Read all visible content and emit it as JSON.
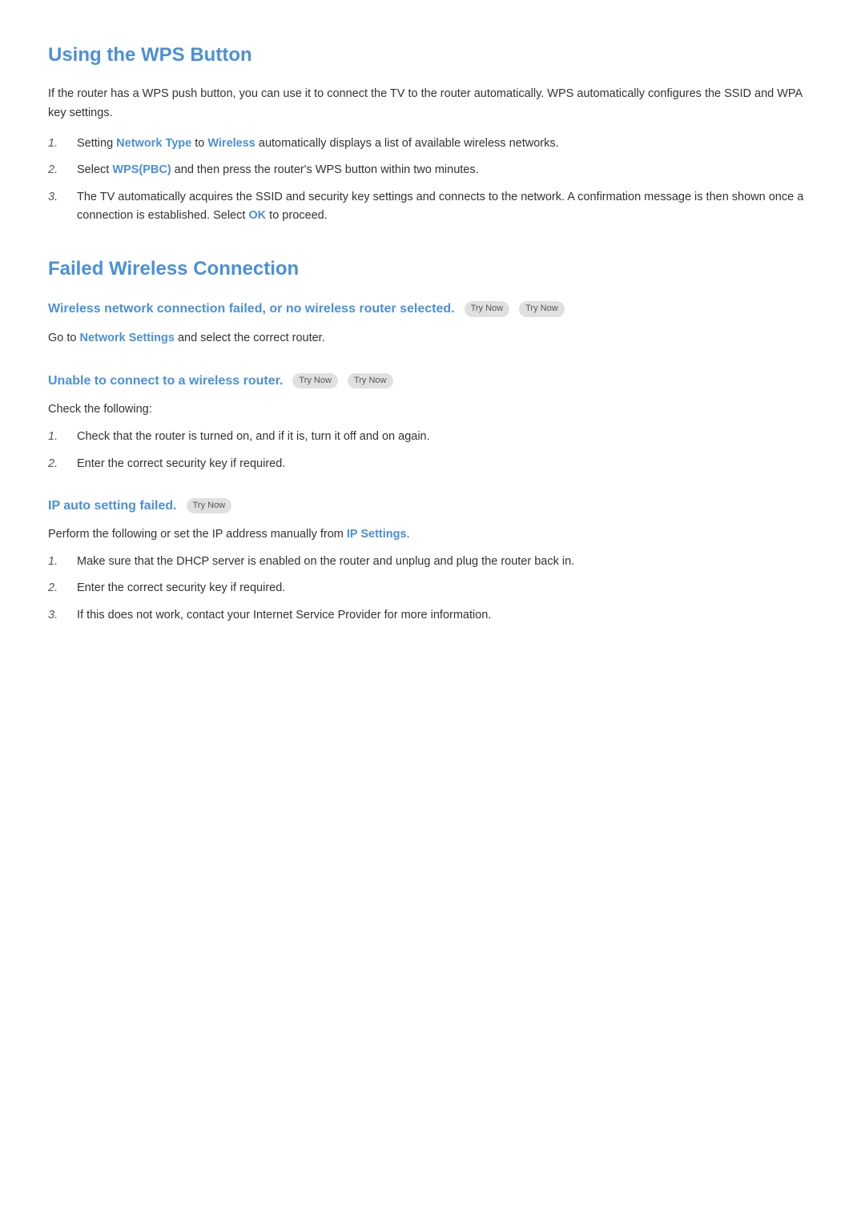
{
  "wps_section": {
    "title": "Using the WPS Button",
    "intro": "If the router has a WPS push button, you can use it to connect the TV to the router automatically. WPS automatically configures the SSID and WPA key settings.",
    "steps": [
      {
        "number": "1.",
        "text_before": "Setting ",
        "link1": "Network Type",
        "text_middle": " to ",
        "link2": "Wireless",
        "text_after": " automatically displays a list of available wireless networks."
      },
      {
        "number": "2.",
        "text_before": "Select ",
        "link1": "WPS(PBC)",
        "text_after": " and then press the router's WPS button within two minutes."
      },
      {
        "number": "3.",
        "text_before": "The TV automatically acquires the SSID and security key settings and connects to the network. A confirmation message is then shown once a connection is established. Select ",
        "link1": "OK",
        "text_after": " to proceed."
      }
    ]
  },
  "failed_section": {
    "title": "Failed Wireless Connection",
    "sub_sections": [
      {
        "id": "no_router",
        "sub_title": "Wireless network connection failed, or no wireless router selected.",
        "badges": [
          "Try Now",
          "Try Now"
        ],
        "body": "Go to ",
        "body_link": "Network Settings",
        "body_after": " and select the correct router."
      },
      {
        "id": "unable_connect",
        "sub_title": "Unable to connect to a wireless router.",
        "badges": [
          "Try Now",
          "Try Now"
        ],
        "check_text": "Check the following:",
        "steps": [
          {
            "number": "1.",
            "text": "Check that the router is turned on, and if it is, turn it off and on again."
          },
          {
            "number": "2.",
            "text": "Enter the correct security key if required."
          }
        ]
      },
      {
        "id": "ip_failed",
        "sub_title": "IP auto setting failed.",
        "badges": [
          "Try Now"
        ],
        "body_before": "Perform the following or set the IP address manually from ",
        "body_link": "IP Settings",
        "body_after": ".",
        "steps": [
          {
            "number": "1.",
            "text": "Make sure that the DHCP server is enabled on the router and unplug and plug the router back in."
          },
          {
            "number": "2.",
            "text": "Enter the correct security key if required."
          },
          {
            "number": "3.",
            "text": "If this does not work, contact your Internet Service Provider for more information."
          }
        ]
      }
    ]
  },
  "labels": {
    "try_now": "Try Now"
  }
}
